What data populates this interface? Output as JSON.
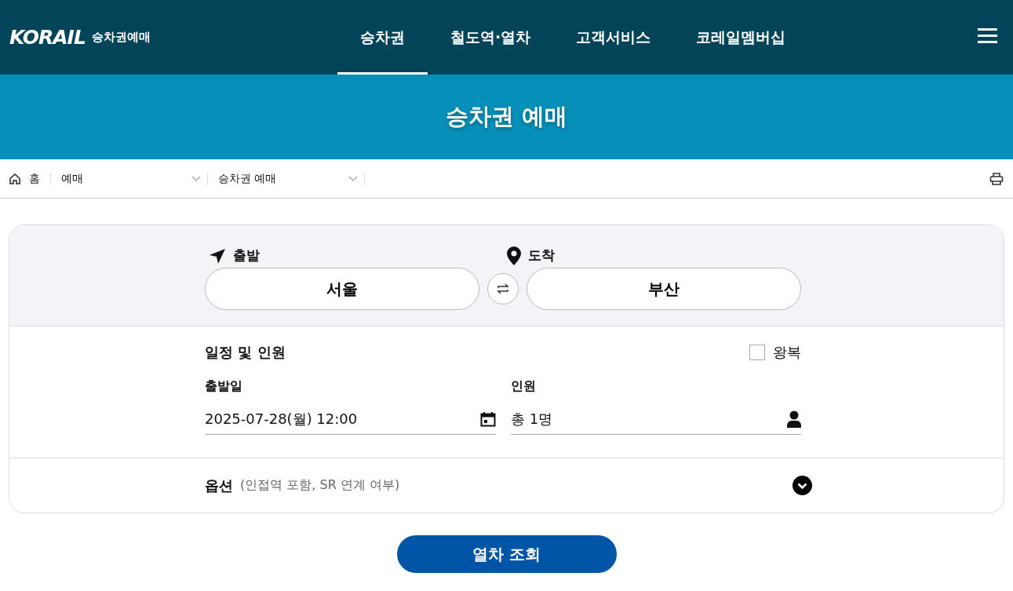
{
  "header": {
    "logo_brand": "KORAIL",
    "logo_subtitle": "승차권예매",
    "nav": [
      {
        "label": "승차권",
        "selected": true
      },
      {
        "label": "철도역·열차",
        "selected": false
      },
      {
        "label": "고객서비스",
        "selected": false
      },
      {
        "label": "코레일멤버십",
        "selected": false
      }
    ]
  },
  "banner": {
    "title": "승차권 예매"
  },
  "breadcrumb": {
    "home": "홈",
    "levels": [
      {
        "label": "예매"
      },
      {
        "label": "승차권 예매"
      }
    ]
  },
  "route": {
    "departure": {
      "label": "출발",
      "value": "서울"
    },
    "arrival": {
      "label": "도착",
      "value": "부산"
    }
  },
  "schedule": {
    "title": "일정 및 인원",
    "round_trip": {
      "label": "왕복",
      "checked": false
    },
    "date": {
      "label": "출발일",
      "value": "2025-07-28(월) 12:00"
    },
    "passengers": {
      "label": "인원",
      "value": "총 1명"
    }
  },
  "options": {
    "title": "옵션",
    "hint": "(인접역 포함, SR 연계 여부)",
    "expanded": false
  },
  "search_button": "열차 조회"
}
